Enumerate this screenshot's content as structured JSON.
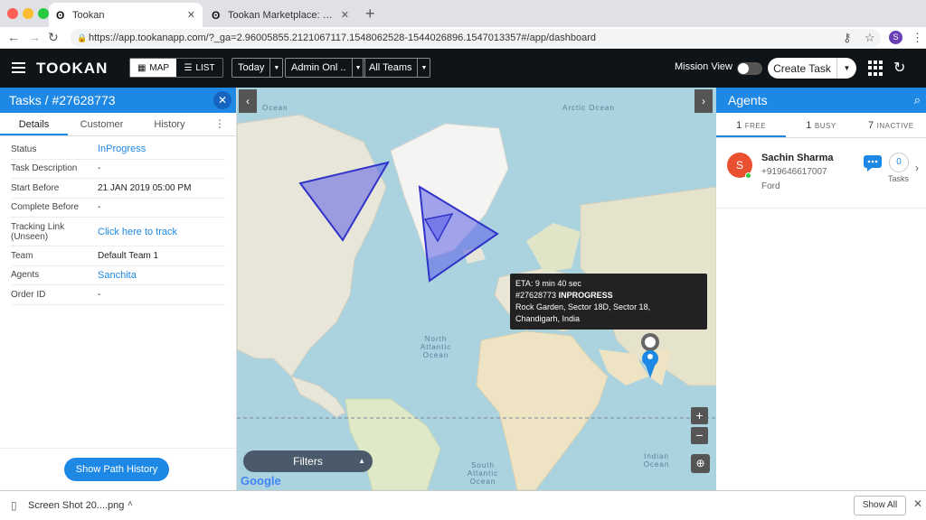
{
  "browser": {
    "tabs": [
      {
        "title": "Tookan",
        "close": "✕"
      },
      {
        "title": "Tookan Marketplace: Explore a",
        "close": "✕"
      }
    ],
    "new_tab": "+",
    "url": "https://app.tookanapp.com/?_ga=2.96005855.2121067117.1548062528-1544026896.1547013357#/app/dashboard",
    "profile_initial": "S"
  },
  "header": {
    "logo": "TOOKAN",
    "view_map": "MAP",
    "view_list": "LIST",
    "date_filter": "Today",
    "user_filter": "Admin Onl ..",
    "team_filter": "All Teams",
    "mission_view": "Mission View",
    "create_task": "Create Task"
  },
  "task_panel": {
    "title": "Tasks / #27628773",
    "tabs": [
      "Details",
      "Customer",
      "History"
    ],
    "rows": [
      {
        "label": "Status",
        "value": "InProgress"
      },
      {
        "label": "Task Description",
        "value": "-"
      },
      {
        "label": "Start Before",
        "value": "21 JAN 2019 05:00 PM"
      },
      {
        "label": "Complete Before",
        "value": "-"
      },
      {
        "label": "Tracking Link (Unseen)",
        "value": "Click here to track"
      },
      {
        "label": "Team",
        "value": "Default Team 1"
      },
      {
        "label": "Agents",
        "value": "Sanchita"
      },
      {
        "label": "Order ID",
        "value": "-"
      }
    ],
    "path_history_button": "Show Path History"
  },
  "map": {
    "labels": {
      "ocean_nw": "Ocean",
      "arctic": "Arctic Ocean",
      "north_atlantic": "North Atlantic Ocean",
      "south_atlantic": "South Atlantic Ocean",
      "indian": "Indian Ocean"
    },
    "tooltip": {
      "eta": "ETA: 9 min 40 sec",
      "task_id": "#27628773",
      "status": "INPROGRESS",
      "address_line1": "Rock Garden, Sector 18D, Sector 18,",
      "address_line2": "Chandigarh, India"
    },
    "filters": "Filters",
    "zoom_in": "+",
    "zoom_out": "−",
    "attribution": "Google"
  },
  "agents_panel": {
    "title": "Agents",
    "tabs": [
      {
        "count": "1",
        "label": "FREE"
      },
      {
        "count": "1",
        "label": "BUSY"
      },
      {
        "count": "7",
        "label": "INACTIVE"
      }
    ],
    "agent": {
      "initial": "S",
      "name": "Sachin Sharma",
      "phone": "+919646617007",
      "vehicle": "Ford",
      "tasks_count": "0",
      "tasks_label": "Tasks"
    }
  },
  "downloads": {
    "file_name": "Screen Shot 20....png",
    "show_all": "Show All"
  },
  "colors": {
    "accent": "#1e88e5",
    "header_bg": "#0f1419",
    "geofence": "#5b5fe8"
  }
}
